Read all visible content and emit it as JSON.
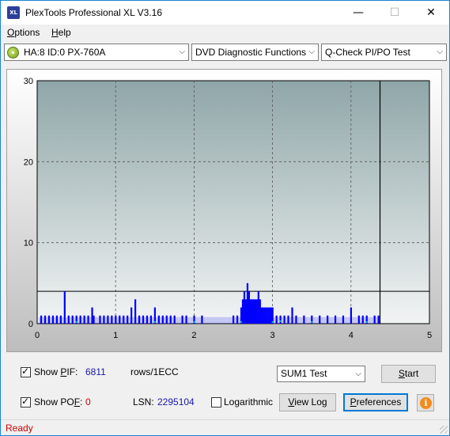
{
  "window": {
    "app_icon_text": "XL",
    "title": "PlexTools Professional XL V3.16",
    "minimize_glyph": "—",
    "maximize_glyph": "☐",
    "close_glyph": "✕"
  },
  "menu": {
    "options": "Options",
    "help": "Help"
  },
  "toolbar": {
    "drive": "HA:8 ID:0  PX-760A",
    "function": "DVD Diagnostic Functions",
    "test": "Q-Check PI/PO Test",
    "arrow": "⌵"
  },
  "chart_data": {
    "type": "bar",
    "xlim": [
      0,
      5
    ],
    "ylim": [
      0,
      30
    ],
    "x_ticks": [
      "0",
      "1",
      "2",
      "3",
      "4",
      "5"
    ],
    "y_ticks": [
      "0",
      "10",
      "20",
      "30"
    ],
    "grid": true,
    "threshold_line": 4,
    "end_marker_x": 4.37,
    "colors": {
      "pif": "#0000ff",
      "pof": "#00c0c0",
      "plot_top": "#8fa6a8",
      "plot_bottom": "#f2f4f4"
    },
    "pif_series": {
      "x": [
        0.05,
        0.1,
        0.15,
        0.2,
        0.25,
        0.3,
        0.35,
        0.4,
        0.45,
        0.5,
        0.55,
        0.6,
        0.65,
        0.7,
        0.72,
        0.8,
        0.85,
        0.9,
        0.95,
        1.0,
        1.05,
        1.1,
        1.15,
        1.2,
        1.25,
        1.3,
        1.35,
        1.4,
        1.45,
        1.5,
        1.55,
        1.6,
        1.65,
        1.7,
        1.75,
        1.85,
        1.9,
        2.0,
        2.1,
        2.5,
        2.55,
        2.6,
        2.62,
        2.64,
        2.66,
        2.68,
        2.7,
        2.72,
        2.74,
        2.76,
        2.78,
        2.8,
        2.82,
        2.84,
        2.86,
        2.88,
        2.9,
        2.92,
        2.94,
        2.96,
        2.98,
        3.0,
        3.05,
        3.1,
        3.15,
        3.2,
        3.25,
        3.3,
        3.4,
        3.5,
        3.6,
        3.7,
        3.8,
        3.9,
        4.0,
        4.1,
        4.15,
        4.2,
        4.3,
        4.35
      ],
      "y": [
        1,
        1,
        1,
        1,
        1,
        1,
        4,
        1,
        1,
        1,
        1,
        1,
        1,
        2,
        1,
        1,
        1,
        1,
        1,
        1,
        1,
        1,
        1,
        2,
        3,
        1,
        1,
        1,
        1,
        2,
        1,
        1,
        1,
        1,
        1,
        1,
        1,
        1,
        1,
        1,
        1,
        2,
        3,
        4,
        3,
        5,
        4,
        3,
        3,
        3,
        3,
        3,
        4,
        3,
        2,
        2,
        2,
        2,
        2,
        2,
        2,
        2,
        1,
        1,
        1,
        1,
        2,
        1,
        1,
        1,
        1,
        1,
        1,
        1,
        2,
        1,
        1,
        1,
        1,
        1
      ]
    },
    "pof_series": {
      "x": [
        0.5,
        1.5,
        2.0,
        2.6,
        3.0,
        3.1,
        3.5,
        4.2
      ],
      "y": [
        0.2,
        0.2,
        0.2,
        0.2,
        0.2,
        0.3,
        0.2,
        0.2
      ]
    }
  },
  "bottom": {
    "show_pif_label": "Show PIF:",
    "pif_value": "6811",
    "rows_label": "rows/1ECC",
    "show_pof_label": "Show POF:",
    "pof_value": "0",
    "lsn_label": "LSN:",
    "lsn_value": "2295104",
    "logarithmic_label": "Logarithmic",
    "sum_test": "SUM1 Test",
    "start_button": "Start",
    "view_log_button": "View Log",
    "preferences_button": "Preferences",
    "info_glyph": "i",
    "show_pif_checked": true,
    "show_pof_checked": true,
    "logarithmic_checked": false
  },
  "status": {
    "text": "Ready"
  }
}
